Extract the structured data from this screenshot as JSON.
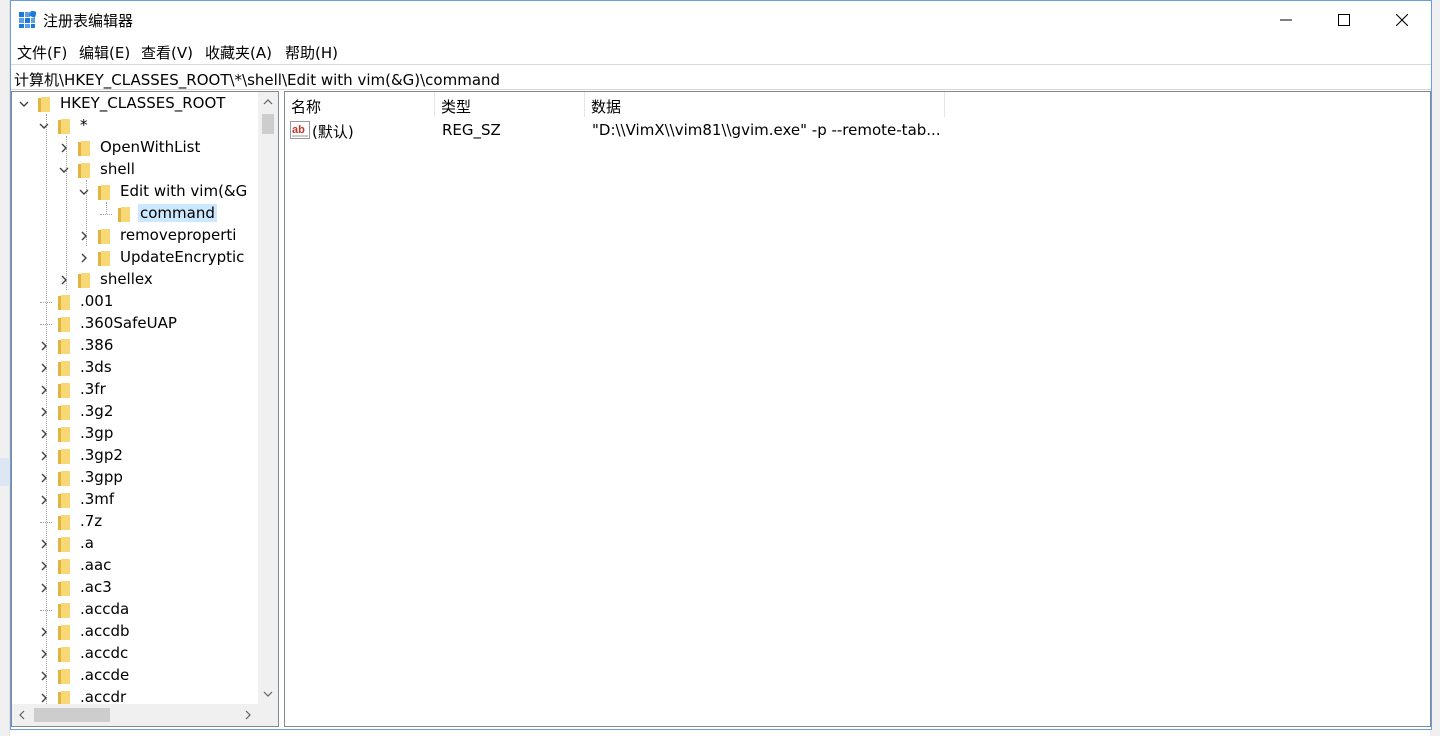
{
  "window": {
    "title": "注册表编辑器"
  },
  "menu": [
    {
      "label": "文件(F)"
    },
    {
      "label": "编辑(E)"
    },
    {
      "label": "查看(V)"
    },
    {
      "label": "收藏夹(A)"
    },
    {
      "label": "帮助(H)"
    }
  ],
  "address": {
    "path": "计算机\\HKEY_CLASSES_ROOT\\*\\shell\\Edit with vim(&G)\\command"
  },
  "tree": {
    "items": [
      {
        "label": "HKEY_CLASSES_ROOT",
        "level": 0,
        "expander": "expanded",
        "icon": "folder-icon"
      },
      {
        "label": "*",
        "level": 1,
        "expander": "expanded",
        "icon": "folder-icon"
      },
      {
        "label": "OpenWithList",
        "level": 2,
        "expander": "collapsed",
        "icon": "folder-icon"
      },
      {
        "label": "shell",
        "level": 2,
        "expander": "expanded",
        "icon": "folder-icon"
      },
      {
        "label": "Edit with vim(&G",
        "level": 3,
        "expander": "expanded",
        "icon": "folder-icon"
      },
      {
        "label": "command",
        "level": 4,
        "expander": "none",
        "icon": "folder-icon",
        "selected": true
      },
      {
        "label": "removeproperti",
        "level": 3,
        "expander": "collapsed",
        "icon": "folder-icon"
      },
      {
        "label": "UpdateEncryptic",
        "level": 3,
        "expander": "collapsed",
        "icon": "folder-icon"
      },
      {
        "label": "shellex",
        "level": 2,
        "expander": "collapsed",
        "icon": "folder-icon"
      },
      {
        "label": ".001",
        "level": 1,
        "expander": "none",
        "icon": "folder-icon"
      },
      {
        "label": ".360SafeUAP",
        "level": 1,
        "expander": "none",
        "icon": "folder-icon"
      },
      {
        "label": ".386",
        "level": 1,
        "expander": "collapsed",
        "icon": "folder-icon"
      },
      {
        "label": ".3ds",
        "level": 1,
        "expander": "collapsed",
        "icon": "folder-icon"
      },
      {
        "label": ".3fr",
        "level": 1,
        "expander": "collapsed",
        "icon": "folder-icon"
      },
      {
        "label": ".3g2",
        "level": 1,
        "expander": "collapsed",
        "icon": "folder-icon"
      },
      {
        "label": ".3gp",
        "level": 1,
        "expander": "collapsed",
        "icon": "folder-icon"
      },
      {
        "label": ".3gp2",
        "level": 1,
        "expander": "collapsed",
        "icon": "folder-icon"
      },
      {
        "label": ".3gpp",
        "level": 1,
        "expander": "collapsed",
        "icon": "folder-icon"
      },
      {
        "label": ".3mf",
        "level": 1,
        "expander": "collapsed",
        "icon": "folder-icon"
      },
      {
        "label": ".7z",
        "level": 1,
        "expander": "none",
        "icon": "folder-icon"
      },
      {
        "label": ".a",
        "level": 1,
        "expander": "collapsed",
        "icon": "folder-icon"
      },
      {
        "label": ".aac",
        "level": 1,
        "expander": "collapsed",
        "icon": "folder-icon"
      },
      {
        "label": ".ac3",
        "level": 1,
        "expander": "collapsed",
        "icon": "folder-icon"
      },
      {
        "label": ".accda",
        "level": 1,
        "expander": "none",
        "icon": "folder-icon"
      },
      {
        "label": ".accdb",
        "level": 1,
        "expander": "collapsed",
        "icon": "folder-icon"
      },
      {
        "label": ".accdc",
        "level": 1,
        "expander": "collapsed",
        "icon": "folder-icon"
      },
      {
        "label": ".accde",
        "level": 1,
        "expander": "collapsed",
        "icon": "folder-icon"
      },
      {
        "label": ".accdr",
        "level": 1,
        "expander": "collapsed",
        "icon": "folder-icon"
      }
    ]
  },
  "list": {
    "columns": [
      {
        "label": "名称"
      },
      {
        "label": "类型"
      },
      {
        "label": "数据"
      }
    ],
    "rows": [
      {
        "name": "(默认)",
        "type": "REG_SZ",
        "data": "\"D:\\\\VimX\\\\vim81\\\\gvim.exe\" -p --remote-tab...",
        "icon": "string-value-icon"
      }
    ]
  },
  "colors": {
    "selection": "#cce8ff",
    "folder": "#f8d775",
    "folder_dark": "#e0b343",
    "window_border": "#6a9ddd",
    "title_icon": "#1e7ad8"
  }
}
